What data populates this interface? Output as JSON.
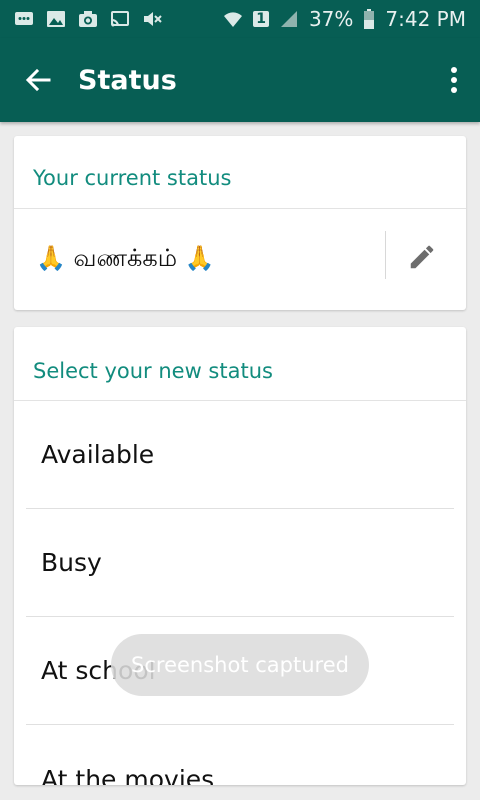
{
  "status_bar": {
    "sim": "1",
    "battery": "37%",
    "time": "7:42 PM",
    "icons": [
      "message-icon",
      "image-icon",
      "camera-icon",
      "cast-icon",
      "mute-icon",
      "wifi-icon",
      "sim-icon",
      "signal-icon",
      "battery-icon"
    ]
  },
  "app_bar": {
    "title": "Status",
    "back_icon": "arrow-left-icon",
    "menu_icon": "more-vert-icon"
  },
  "current": {
    "label": "Your current status",
    "text": "🙏 வணக்கம் 🙏",
    "edit_icon": "pencil-icon"
  },
  "select": {
    "label": "Select your new status",
    "items": [
      "Available",
      "Busy",
      "At school",
      "At the movies"
    ]
  },
  "toast": {
    "text": "Screenshot captured"
  },
  "colors": {
    "primary_dark": "#075e54",
    "accent": "#128c7e"
  }
}
